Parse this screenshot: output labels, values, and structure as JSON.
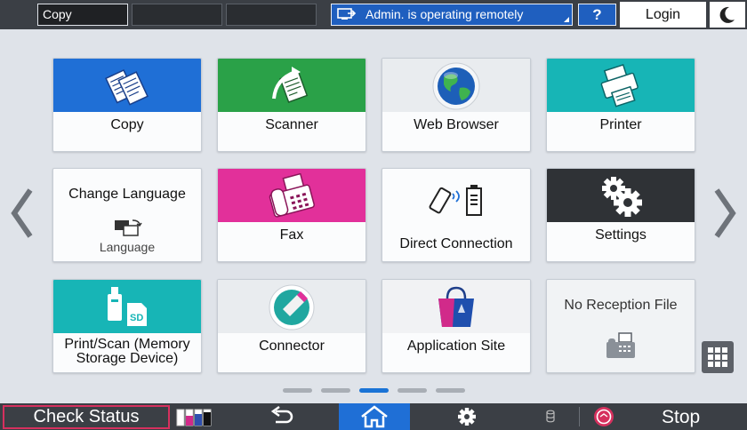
{
  "topbar": {
    "slot1": "Copy",
    "remote_status": "Admin. is operating remotely",
    "help_label": "?",
    "login_label": "Login",
    "icons": {
      "remote": "remote-pc-icon",
      "energy": "moon-icon"
    }
  },
  "tiles": [
    {
      "label": "Copy",
      "band": "#1f6fd6",
      "icon": "copy-icon"
    },
    {
      "label": "Scanner",
      "band": "#2aa148",
      "icon": "scanner-icon"
    },
    {
      "label": "Web Browser",
      "band": "#e9ecef",
      "icon": "globe-icon"
    },
    {
      "label": "Printer",
      "band": "#17b5b6",
      "icon": "printer-icon"
    },
    {
      "label": "Change Language",
      "sublabel": "Language",
      "icon": "language-icon"
    },
    {
      "label": "Fax",
      "band": "#e2309a",
      "icon": "fax-icon"
    },
    {
      "label": "Direct Connection",
      "icon": "direct-connection-icon"
    },
    {
      "label": "Settings",
      "band": "#2f3236",
      "icon": "gear-icon"
    },
    {
      "label_line1": "Print/Scan (Memory",
      "label_line2": "Storage Device)",
      "band": "#17b5b6",
      "icon": "usb-sd-icon"
    },
    {
      "label": "Connector",
      "band": "#e9ecef",
      "icon": "connector-icon"
    },
    {
      "label": "Application Site",
      "band": "#f1f2f4",
      "icon": "shopping-bag-icon"
    },
    {
      "label": "No Reception File",
      "icon": "fax-machine-icon"
    }
  ],
  "pager": {
    "pages": 5,
    "current": 3
  },
  "bottombar": {
    "check_status": "Check Status",
    "stop_label": "Stop",
    "colors": {
      "home": "#1f6fd6",
      "check_status_border": "#d6305e",
      "stop_icon": "#d6305e"
    }
  }
}
